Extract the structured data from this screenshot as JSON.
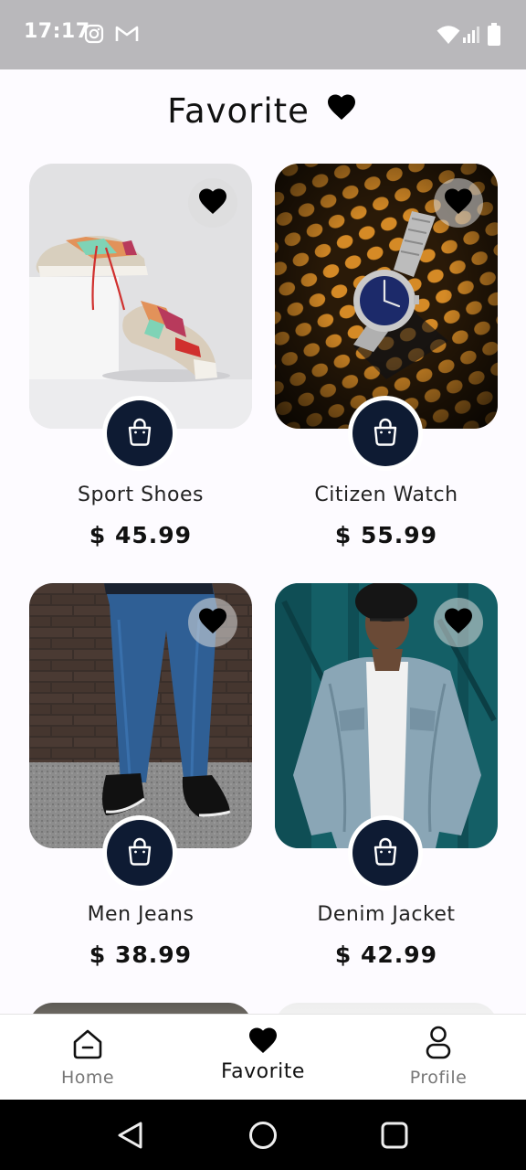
{
  "status_bar": {
    "time": "17:17",
    "icons": [
      "instagram-icon",
      "gmail-icon",
      "wifi-icon",
      "signal-icon",
      "battery-icon"
    ]
  },
  "header": {
    "title": "Favorite",
    "icon": "heart-icon"
  },
  "products": [
    {
      "name": "Sport Shoes",
      "price": "$ 45.99",
      "image": "sneakers-photo",
      "favorite_icon": "heart-icon",
      "cart_icon": "shopping-bag-icon"
    },
    {
      "name": "Citizen Watch",
      "price": "$ 55.99",
      "image": "wristwatch-photo",
      "favorite_icon": "heart-icon",
      "cart_icon": "shopping-bag-icon"
    },
    {
      "name": "Men Jeans",
      "price": "$ 38.99",
      "image": "jeans-photo",
      "favorite_icon": "heart-icon",
      "cart_icon": "shopping-bag-icon"
    },
    {
      "name": "Denim Jacket",
      "price": "$ 42.99",
      "image": "denim-jacket-photo",
      "favorite_icon": "heart-icon",
      "cart_icon": "shopping-bag-icon"
    }
  ],
  "bottom_nav": {
    "items": [
      {
        "label": "Home",
        "icon": "home-icon",
        "active": false
      },
      {
        "label": "Favorite",
        "icon": "heart-icon",
        "active": true
      },
      {
        "label": "Profile",
        "icon": "person-icon",
        "active": false
      }
    ]
  },
  "system_nav": {
    "icons": [
      "back-icon",
      "home-circle-icon",
      "recents-icon"
    ]
  },
  "colors": {
    "accent": "#0e1b33",
    "status_bar": "#b9b8bb",
    "background": "#fdfbff",
    "inactive_text": "#777777"
  }
}
